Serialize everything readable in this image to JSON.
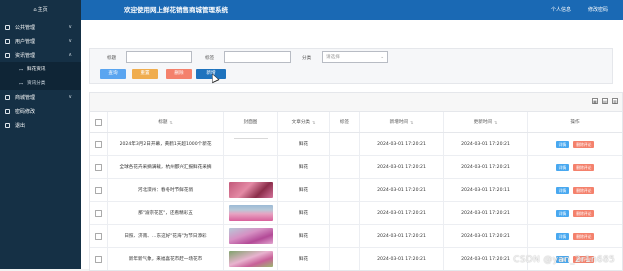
{
  "sidebar": {
    "home_label": "主页",
    "items": [
      {
        "label": "公共管理",
        "icon": "grid-icon",
        "arrow": "∨"
      },
      {
        "label": "用户管理",
        "icon": "users-icon",
        "arrow": "∨"
      },
      {
        "label": "资讯管理",
        "icon": "news-icon",
        "arrow": "∧"
      }
    ],
    "submenu": [
      {
        "label": "鲜花资讯",
        "icon": "link-icon",
        "active": true
      },
      {
        "label": "资讯分类",
        "icon": "link-icon",
        "active": false
      }
    ],
    "items_after": [
      {
        "label": "商城管理",
        "icon": "shop-icon",
        "arrow": "∨"
      },
      {
        "label": "密码修改",
        "icon": "key-icon",
        "arrow": ""
      },
      {
        "label": "退出",
        "icon": "logout-icon",
        "arrow": ""
      }
    ]
  },
  "header": {
    "title": "欢迎使用网上鲜花销售商城管理系统",
    "links": [
      "个人信息",
      "修改密码"
    ]
  },
  "filters": {
    "title_label": "标题",
    "tag_label": "标签",
    "category_label": "分类",
    "category_placeholder": "请选择",
    "title_value": "",
    "tag_value": ""
  },
  "buttons": {
    "search": "查询",
    "reset": "重置",
    "delete": "删除",
    "add": "新增"
  },
  "colors": {
    "sidebar": "#153045",
    "header": "#1a69b4",
    "search": "#5aa5f0",
    "reset": "#f0ad4e",
    "delete": "#f4816c",
    "add": "#1e73be",
    "detail": "#48a8f0",
    "delete_small": "#f4816c"
  },
  "table": {
    "columns": [
      "标题",
      "封面图",
      "文章分类",
      "标签",
      "新增时间",
      "更新时间",
      "操作"
    ],
    "rows": [
      {
        "title": "2024年3月2日开幕，黄鹤1天超1000个新花",
        "cover": "line",
        "type": "鲜花",
        "tag": "",
        "created": "2024-03-01 17:20:21",
        "updated": "2024-03-01 17:20:21"
      },
      {
        "title": "全球各花卉采摘满载，杭州都兴汇报鲜花采摘",
        "cover": "",
        "type": "鲜花",
        "tag": "",
        "created": "2024-03-01 17:20:21",
        "updated": "2024-03-01 17:20:21"
      },
      {
        "title": "河北滦州：春冬时节鲜花俏",
        "cover": "pink",
        "type": "鲜花",
        "tag": "",
        "created": "2024-03-01 17:20:21",
        "updated": "2024-03-01 17:20:11"
      },
      {
        "title": "那\"渝宗花区\"，还看精彩五",
        "cover": "field",
        "type": "鲜花",
        "tag": "",
        "created": "2024-03-01 17:20:21",
        "updated": "2024-03-01 17:20:21"
      },
      {
        "title": "日照、济南、…东这好\"花海\"为节日添彩",
        "cover": "purple",
        "type": "鲜花",
        "tag": "",
        "created": "2024-03-01 17:20:21",
        "updated": "2024-03-01 17:20:21"
      },
      {
        "title": "新年新气象，来福喜花市赶一场花市",
        "cover": "bloom",
        "type": "鲜花",
        "tag": "",
        "created": "2024-03-01 17:20:21",
        "updated": "2024-03-01 17:20:21"
      }
    ],
    "op_detail": "详情",
    "op_delete": "删除评论"
  },
  "watermark": "CSDN @yan_2r1n685"
}
